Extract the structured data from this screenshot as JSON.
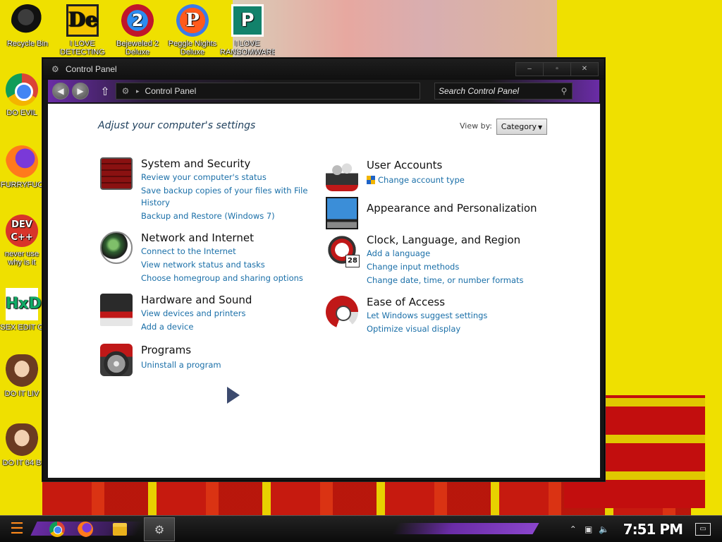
{
  "desktop": {
    "icons": [
      {
        "label": "Recycle Bin"
      },
      {
        "label": "I LOVE DETECTING"
      },
      {
        "label": "Bejeweled 2 Deluxe"
      },
      {
        "label": "Peggle Nights Deluxe"
      },
      {
        "label": "I LOVE RANSOMWARE"
      },
      {
        "label": "DO EVIL"
      },
      {
        "label": "FURRYFUC"
      },
      {
        "label": "never use why is it"
      },
      {
        "label": "SEX EDIT O"
      },
      {
        "label": "DO IT LIV"
      },
      {
        "label": "DO IT 64 B"
      }
    ]
  },
  "window": {
    "title": "Control Panel",
    "controls": {
      "minimize": "–",
      "maximize": "▫",
      "close": "✕"
    },
    "address": {
      "crumb": "Control Panel"
    },
    "search": {
      "placeholder": "Search Control Panel"
    }
  },
  "content": {
    "heading": "Adjust your computer's settings",
    "view_by_label": "View by:",
    "view_by_value": "Category",
    "categories_left": [
      {
        "title": "System and Security",
        "links": [
          "Review your computer's status",
          "Save backup copies of your files with File",
          "History",
          "Backup and Restore (Windows 7)"
        ]
      },
      {
        "title": "Network and Internet",
        "links": [
          "Connect to the Internet",
          "View network status and tasks",
          "Choose homegroup and sharing options"
        ]
      },
      {
        "title": "Hardware and Sound",
        "links": [
          "View devices and printers",
          "Add a device"
        ]
      },
      {
        "title": "Programs",
        "links": [
          "Uninstall a program"
        ]
      }
    ],
    "categories_right": [
      {
        "title": "User Accounts",
        "links": [
          "Change account type"
        ]
      },
      {
        "title": "Appearance and Personalization",
        "links": []
      },
      {
        "title": "Clock, Language, and Region",
        "links": [
          "Add a language",
          "Change input methods",
          "Change date, time, or number formats"
        ],
        "calendar_day": "28"
      },
      {
        "title": "Ease of Access",
        "links": [
          "Let Windows suggest settings",
          "Optimize visual display"
        ]
      }
    ]
  },
  "taskbar": {
    "clock": "7:51 PM"
  },
  "colors": {
    "link": "#1a6fa8",
    "heading": "#1e3f5c",
    "accent_purple": "#6a2ca6"
  }
}
